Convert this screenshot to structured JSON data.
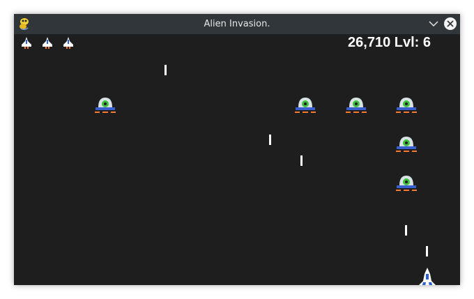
{
  "window": {
    "title": "Alien Invasion."
  },
  "hud": {
    "score": "26,710",
    "level_label": "Lvl:",
    "level": "6",
    "lives": 3
  },
  "colors": {
    "background": "#1e1e1e",
    "titlebar": "#31363b",
    "text": "#ffffff",
    "alien_dome": "#d8e4e4",
    "alien_eye": "#3fbf3f",
    "alien_saucer": "#3a5fcf",
    "alien_lights": "#ff7a30",
    "ship_body": "#ffffff",
    "ship_blue": "#2a5fd6",
    "ship_flame": "#ff7a30"
  },
  "icons": {
    "app": "pygame-snake-icon",
    "minimize": "chevron-down-icon",
    "close": "close-icon"
  }
}
